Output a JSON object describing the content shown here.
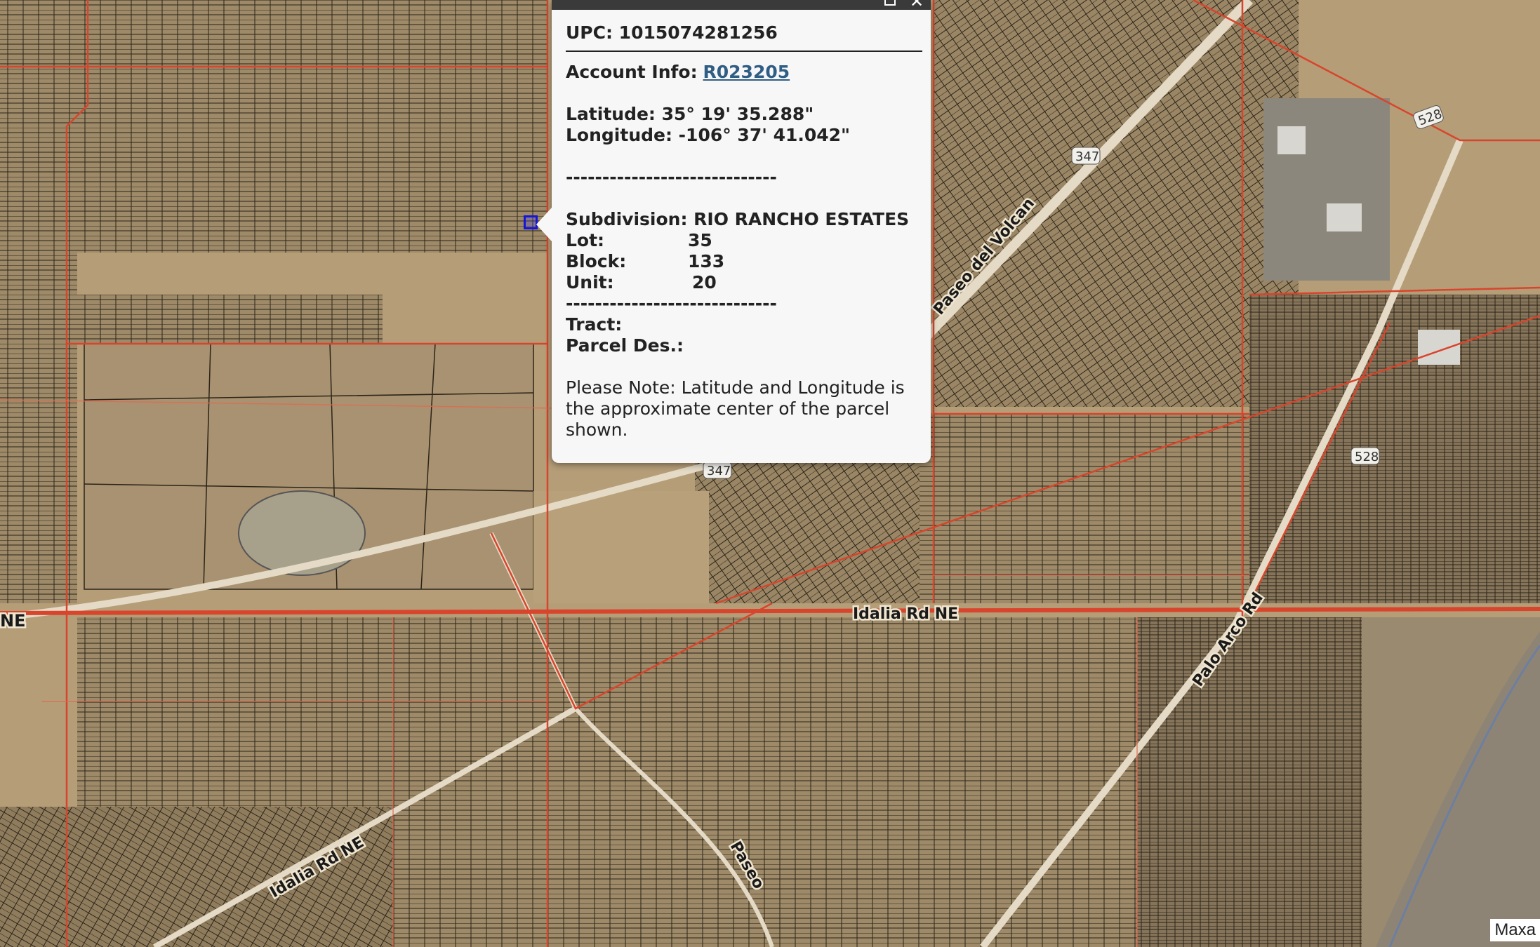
{
  "map": {
    "road_labels": {
      "left_ne": "NE",
      "center_road": "Idalia Rd NE",
      "lower_left_road": "Idalia Rd NE",
      "paseo": "Paseo",
      "lower_center_road": "Rd NE",
      "right_diagonal": "Paseo del Volcan",
      "palo_arco": "Palo Arco Rd"
    },
    "shields": {
      "upper": "347",
      "middle": "347",
      "right": "528",
      "top_right": "528"
    },
    "attribution": "Maxa"
  },
  "popup": {
    "upc": "UPC: 1015074281256",
    "account_label": "Account Info:",
    "account_link": "R023205",
    "latitude": "Latitude: 35° 19' 35.288\"",
    "longitude": "Longitude: -106° 37' 41.042\"",
    "divider1": "-----------------------------",
    "subdivision": "Subdivision: RIO RANCHO ESTATES",
    "lot_label": "Lot:",
    "lot_value": "35",
    "block_label": "Block:",
    "block_value": "133",
    "unit_label": "Unit:",
    "unit_value": "20",
    "divider2": "-----------------------------",
    "tract_label": "Tract:",
    "parcel_label": "Parcel Des.:",
    "note": "Please Note: Latitude and Longitude is the approximate center of the parcel shown."
  },
  "colors": {
    "parcel_boundary": "#d8452c",
    "lot_lines": "#2b2418",
    "terrain": "#b59d78",
    "link": "#2f5d84"
  }
}
